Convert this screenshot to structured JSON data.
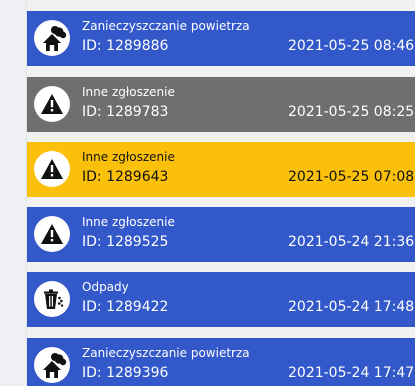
{
  "reports": [
    {
      "category": "Zanieczyszczanie powietrza",
      "id_label": "ID: 1289886",
      "datetime": "2021-05-25 08:46",
      "icon": "air-pollution-icon",
      "color": "#3358c9"
    },
    {
      "category": "Inne zgłoszenie",
      "id_label": "ID: 1289783",
      "datetime": "2021-05-25 08:25",
      "icon": "warning-icon",
      "color": "#6f6f6f"
    },
    {
      "category": "Inne zgłoszenie",
      "id_label": "ID: 1289643",
      "datetime": "2021-05-25 07:08",
      "icon": "warning-icon",
      "color": "#fbc10a"
    },
    {
      "category": "Inne zgłoszenie",
      "id_label": "ID: 1289525",
      "datetime": "2021-05-24 21:36",
      "icon": "warning-icon",
      "color": "#3358c9"
    },
    {
      "category": "Odpady",
      "id_label": "ID: 1289422",
      "datetime": "2021-05-24 17:48",
      "icon": "waste-bin-icon",
      "color": "#3358c9"
    },
    {
      "category": "Zanieczyszczanie powietrza",
      "id_label": "ID: 1289396",
      "datetime": "2021-05-24 17:47",
      "icon": "air-pollution-icon",
      "color": "#3358c9"
    }
  ]
}
